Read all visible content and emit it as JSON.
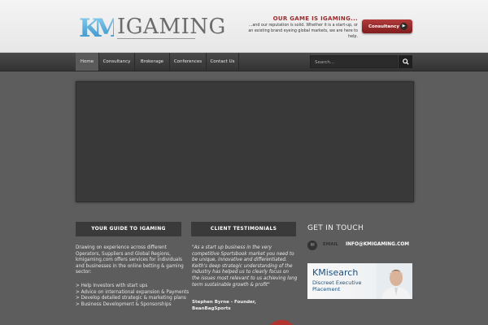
{
  "header": {
    "logo_text": "IGAMING",
    "tagline_title": "OUR GAME IS IGAMING...",
    "tagline_text": "...and our reputation is solid. Whether it is a start-up, or an existing brand eyeing global markets, we are here to help.",
    "consult_button": "Consultancy"
  },
  "nav": {
    "items": [
      {
        "label": "Home"
      },
      {
        "label": "Consultancy"
      },
      {
        "label": "Brokerage"
      },
      {
        "label": "Conferences"
      },
      {
        "label": "Contact Us"
      }
    ],
    "search_placeholder": "Search..."
  },
  "guide": {
    "heading": "YOUR GUIDE TO IGAMING",
    "text": "Drawing on experience across different Operators, Suppliers and Global Regions, kmigaming.com offers services for individuals and businesses in the online betting & gaming sector:",
    "list": [
      "> Help Investors with start ups",
      "> Advice on international expansion & Payments",
      "> Develop detailed strategic & marketing plans",
      "> Business Development & Sponsorships"
    ]
  },
  "testimonials": {
    "heading": "CLIENT TESTIMONIALS",
    "quote": "\"As a start up business in the very competitive Sportsbook market you need to be unique, innovative and differentiated. Keith's deep strategic understanding of the industry has helped us to clearly focus on the issues most relevant to us achieving long term sustainable growth & profit\"",
    "author_line1": "Stephen Byrne - Founder,",
    "author_line2": "BeanBagSports"
  },
  "contact": {
    "heading": "GET IN TOUCH",
    "email_label": "EMAIL",
    "email_value": "INFO@KMIGAMING.COM"
  },
  "ad": {
    "title": "KMisearch",
    "subtitle": "Discreet Executive Placement"
  },
  "colors": {
    "accent": "#9c2b2b",
    "background": "#5d5d5d",
    "heading_bg": "#3a3a3a"
  }
}
